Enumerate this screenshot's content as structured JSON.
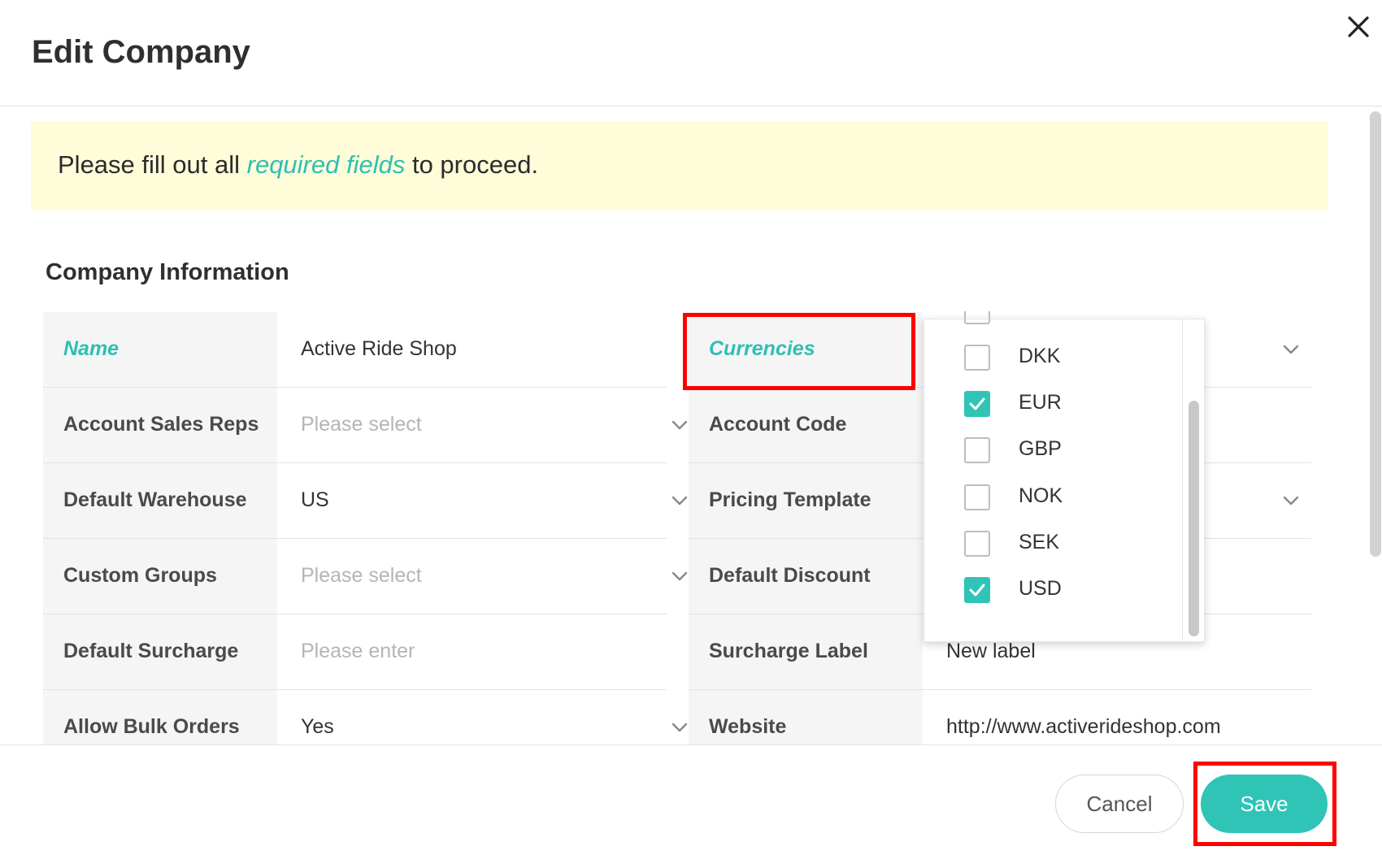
{
  "modal": {
    "title": "Edit Company",
    "close_icon": "close-icon"
  },
  "notice": {
    "prefix": "Please fill out all ",
    "link": "required fields",
    "suffix": " to proceed.",
    "background_color": "#fffcd9",
    "link_color": "#2fbfb3"
  },
  "section": {
    "title": "Company Information"
  },
  "left_fields": [
    {
      "label": "Name",
      "value": "Active Ride Shop",
      "required": true,
      "type": "text"
    },
    {
      "label": "Account Sales Reps",
      "placeholder": "Please select",
      "type": "select"
    },
    {
      "label": "Default Warehouse",
      "value": "US",
      "type": "select"
    },
    {
      "label": "Custom Groups",
      "placeholder": "Please select",
      "type": "select"
    },
    {
      "label": "Default Surcharge",
      "placeholder": "Please enter",
      "type": "text"
    },
    {
      "label": "Allow Bulk Orders",
      "value": "Yes",
      "type": "select"
    }
  ],
  "right_fields": [
    {
      "label": "Currencies",
      "required": true,
      "type": "multiselect"
    },
    {
      "label": "Account Code",
      "type": "text"
    },
    {
      "label": "Pricing Template",
      "type": "select"
    },
    {
      "label": "Default Discount",
      "type": "text"
    },
    {
      "label": "Surcharge Label",
      "value": "New label",
      "type": "text"
    },
    {
      "label": "Website",
      "value": "http://www.activerideshop.com",
      "type": "text"
    }
  ],
  "currency_dropdown": {
    "options": [
      {
        "code": "DKK",
        "checked": false
      },
      {
        "code": "EUR",
        "checked": true
      },
      {
        "code": "GBP",
        "checked": false
      },
      {
        "code": "NOK",
        "checked": false
      },
      {
        "code": "SEK",
        "checked": false
      },
      {
        "code": "USD",
        "checked": true
      }
    ],
    "check_color": "#2fc4b6"
  },
  "footer": {
    "cancel_label": "Cancel",
    "save_label": "Save",
    "accent_color": "#2fc4b6"
  },
  "annotations": {
    "highlight_color": "#ff0000"
  }
}
